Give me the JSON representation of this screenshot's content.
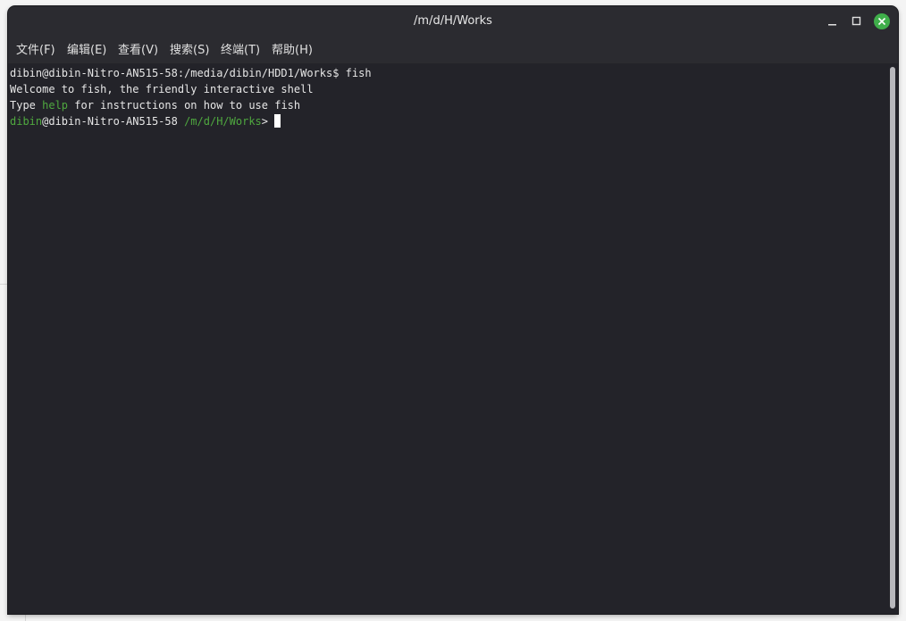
{
  "window": {
    "title": "/m/d/H/Works"
  },
  "menu": {
    "items": [
      {
        "label": "文件(F)"
      },
      {
        "label": "编辑(E)"
      },
      {
        "label": "查看(V)"
      },
      {
        "label": "搜索(S)"
      },
      {
        "label": "终端(T)"
      },
      {
        "label": "帮助(H)"
      }
    ]
  },
  "terminal": {
    "line1": "dibin@dibin-Nitro-AN515-58:/media/dibin/HDD1/Works$ fish",
    "line2": "Welcome to fish, the friendly interactive shell",
    "line3_pre": "Type ",
    "line3_cmd": "help",
    "line3_post": " for instructions on how to use fish",
    "prompt_user": "dibin",
    "prompt_host": "@dibin-Nitro-AN515-58",
    "prompt_path": "/m/d/H/Works",
    "prompt_symbol": ">"
  },
  "colors": {
    "terminal_bg": "#232329",
    "prompt_green": "#4fa83f",
    "close_button": "#3fae4a"
  }
}
